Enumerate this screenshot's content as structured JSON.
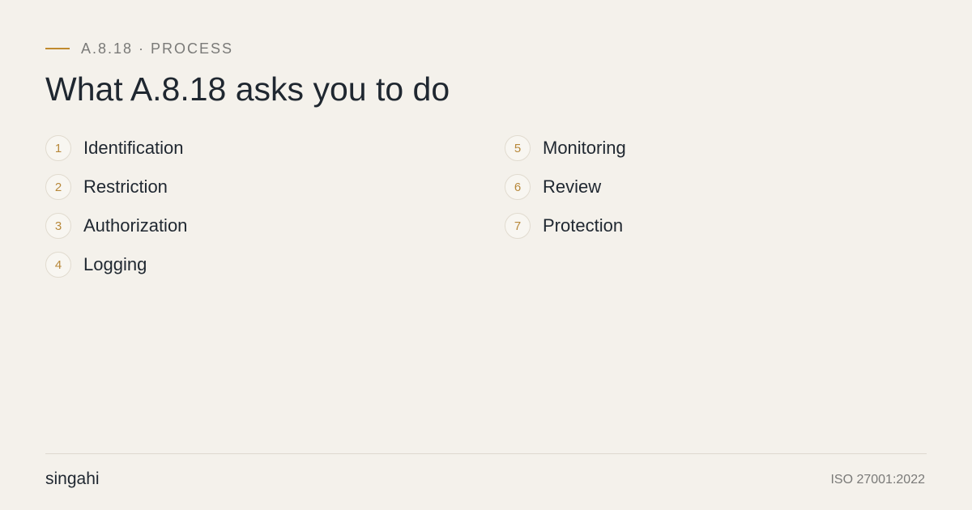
{
  "header": {
    "eyebrow": "A.8.18 · PROCESS",
    "title": "What A.8.18 asks you to do"
  },
  "steps": [
    {
      "number": "1",
      "label": "Identification"
    },
    {
      "number": "2",
      "label": "Restriction"
    },
    {
      "number": "3",
      "label": "Authorization"
    },
    {
      "number": "4",
      "label": "Logging"
    },
    {
      "number": "5",
      "label": "Monitoring"
    },
    {
      "number": "6",
      "label": "Review"
    },
    {
      "number": "7",
      "label": "Protection"
    }
  ],
  "footer": {
    "brand": "singahi",
    "standard": "ISO 27001:2022"
  },
  "colors": {
    "background": "#f4f1eb",
    "accent": "#c08a2e",
    "text": "#1f2730",
    "muted": "#7a7a78"
  }
}
